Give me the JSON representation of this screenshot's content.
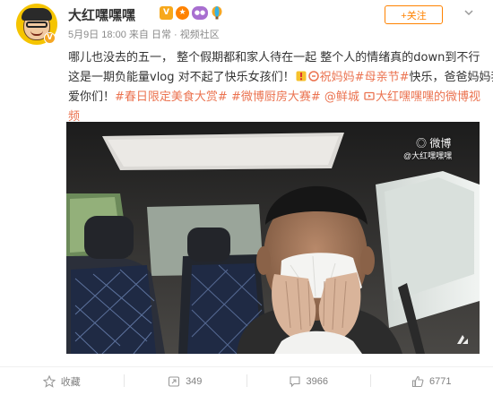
{
  "header": {
    "username": "大红嘿嘿嘿",
    "date": "5月9日 18:00",
    "source_prefix": "来自",
    "source": "日常 · 视频社区",
    "follow_label": "+关注",
    "avatar_badge": "V"
  },
  "post": {
    "line1": "哪儿也没去的五一， 整个假期都和家人待在一起 整个人的情绪真的down到不行",
    "line2_a": "这是一期负能量vlog 对不起了快乐女孩们！",
    "line2_b": "祝妈妈",
    "line2_tag": "#母亲节#",
    "line2_c": "快乐，爸爸妈妈我",
    "line3_a": "爱你们！",
    "line3_tag1": "#春日限定美食大赏#",
    "line3_tag2": "#微博厨房大赛#",
    "line3_mention": "@鲜城",
    "line3_video": "大红嘿嘿嘿的微博视",
    "line4_video": "频"
  },
  "video": {
    "watermark": "微博",
    "watermark_sub": "@大红嘿嘿嘿"
  },
  "footer": {
    "collect_label": "收藏",
    "repost_count": "349",
    "comment_count": "3966",
    "like_count": "6771"
  },
  "colors": {
    "accent": "#ff8200",
    "link": "#eb7350",
    "muted": "#8b8b8b"
  }
}
